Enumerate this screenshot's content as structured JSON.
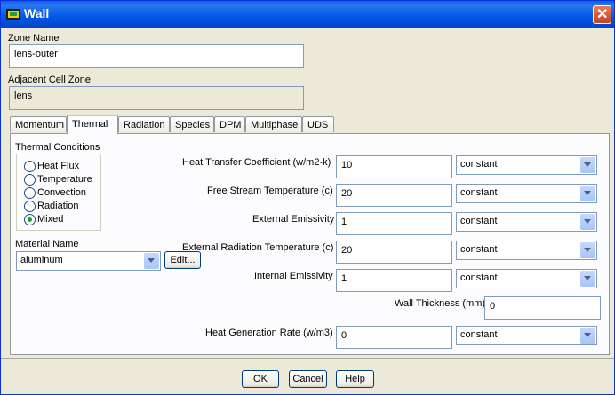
{
  "window": {
    "title": "Wall"
  },
  "zone_name": {
    "label": "Zone Name",
    "value": "lens-outer"
  },
  "adjacent_cell_zone": {
    "label": "Adjacent Cell Zone",
    "value": "lens"
  },
  "tabs": [
    "Momentum",
    "Thermal",
    "Radiation",
    "Species",
    "DPM",
    "Multiphase",
    "UDS"
  ],
  "active_tab": "Thermal",
  "thermal_conditions": {
    "label": "Thermal Conditions",
    "options": [
      "Heat Flux",
      "Temperature",
      "Convection",
      "Radiation",
      "Mixed"
    ],
    "selected": "Mixed"
  },
  "material": {
    "label": "Material Name",
    "value": "aluminum",
    "edit_label": "Edit..."
  },
  "fields": [
    {
      "label": "Heat Transfer Coefficient (w/m2-k)",
      "value": "10",
      "method": "constant"
    },
    {
      "label": "Free Stream Temperature (c)",
      "value": "20",
      "method": "constant"
    },
    {
      "label": "External Emissivity",
      "value": "1",
      "method": "constant"
    },
    {
      "label": "External Radiation Temperature (c)",
      "value": "20",
      "method": "constant"
    },
    {
      "label": "Internal Emissivity",
      "value": "1",
      "method": "constant"
    }
  ],
  "wall_thickness": {
    "label": "Wall Thickness (mm)",
    "value": "0"
  },
  "heat_generation": {
    "label": "Heat Generation Rate (w/m3)",
    "value": "0",
    "method": "constant"
  },
  "buttons": {
    "ok": "OK",
    "cancel": "Cancel",
    "help": "Help"
  },
  "icons": {
    "title": "fluent-app-icon",
    "close": "close-icon",
    "dropdown": "chevron-down-icon"
  }
}
